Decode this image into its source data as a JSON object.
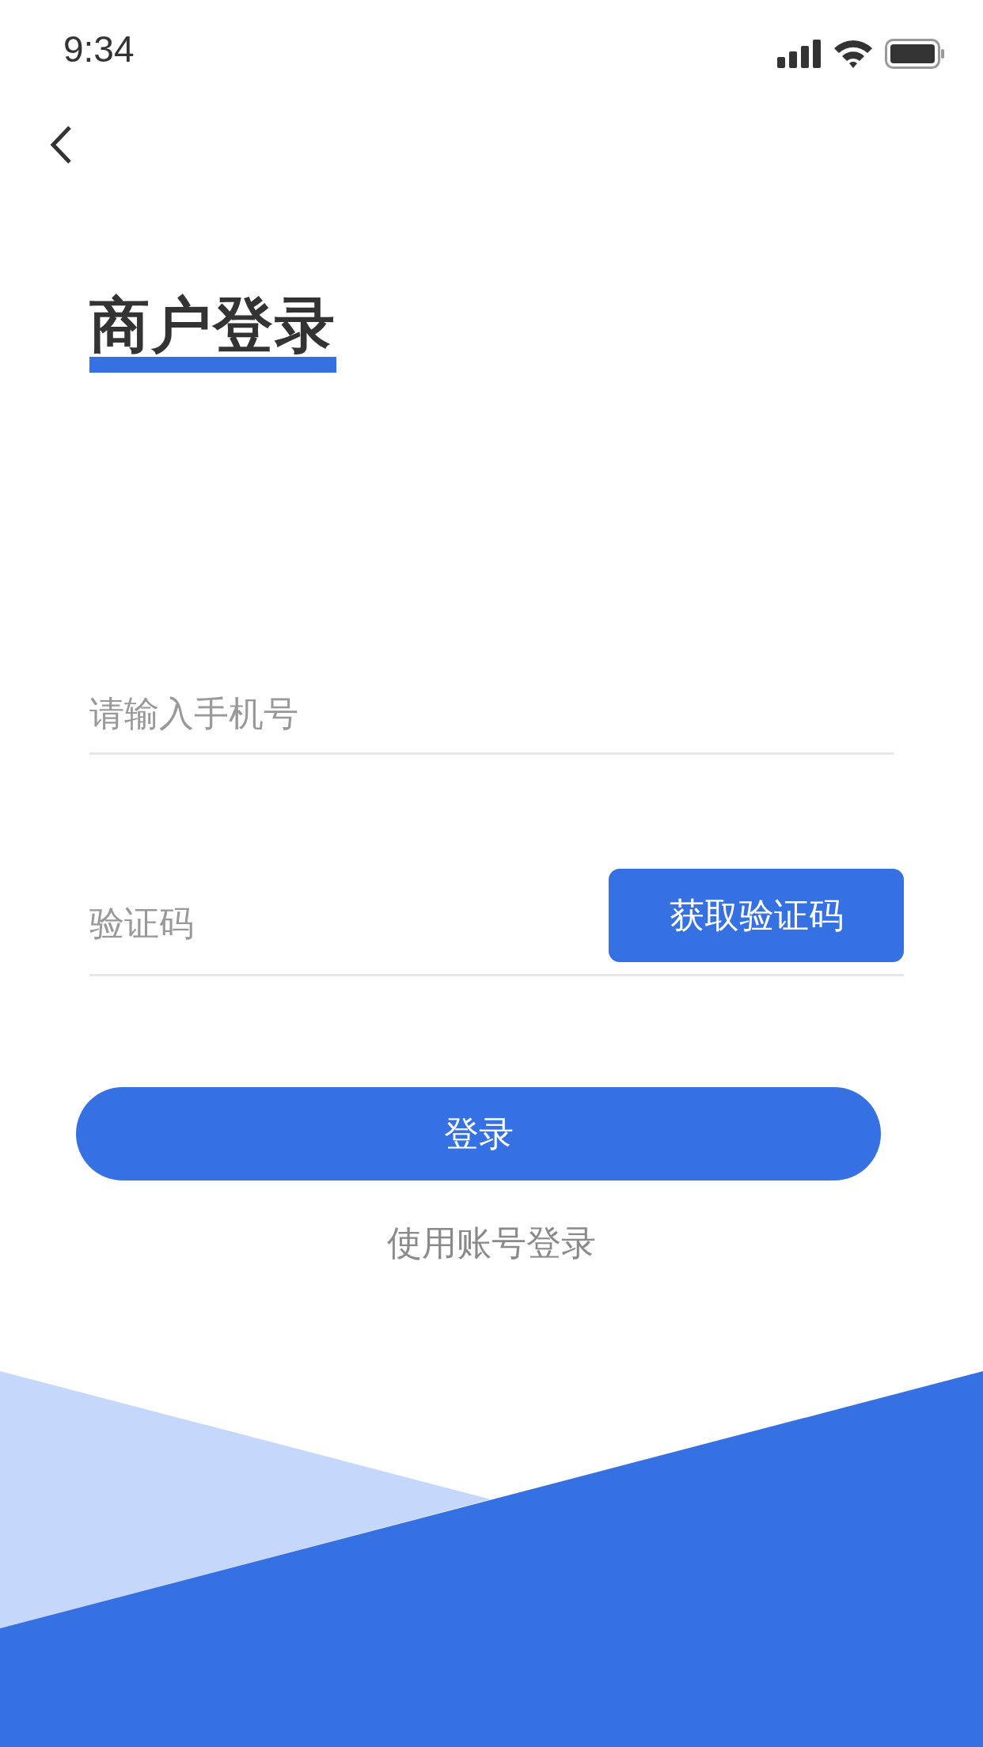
{
  "status_bar": {
    "time": "9:34"
  },
  "title": "商户登录",
  "phone_field": {
    "placeholder": "请输入手机号"
  },
  "code_field": {
    "placeholder": "验证码"
  },
  "get_code_button": "获取验证码",
  "login_button": "登录",
  "alt_login_link": "使用账号登录"
}
